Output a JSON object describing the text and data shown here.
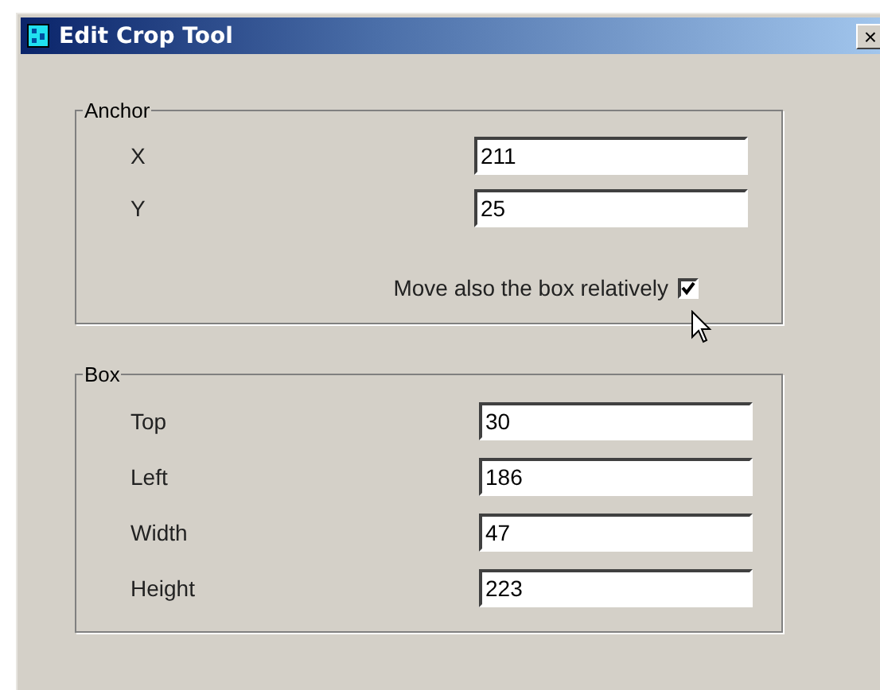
{
  "window": {
    "title": "Edit Crop Tool",
    "close": "×"
  },
  "anchor": {
    "title": "Anchor",
    "fields": [
      {
        "label": "X",
        "value": "211"
      },
      {
        "label": "Y",
        "value": "25"
      }
    ],
    "checkbox": {
      "label": "Move also the box relatively",
      "checked": true
    }
  },
  "box": {
    "title": "Box",
    "fields": [
      {
        "label": "Top",
        "value": "30"
      },
      {
        "label": "Left",
        "value": "186"
      },
      {
        "label": "Width",
        "value": "47"
      },
      {
        "label": "Height",
        "value": "223"
      }
    ]
  }
}
